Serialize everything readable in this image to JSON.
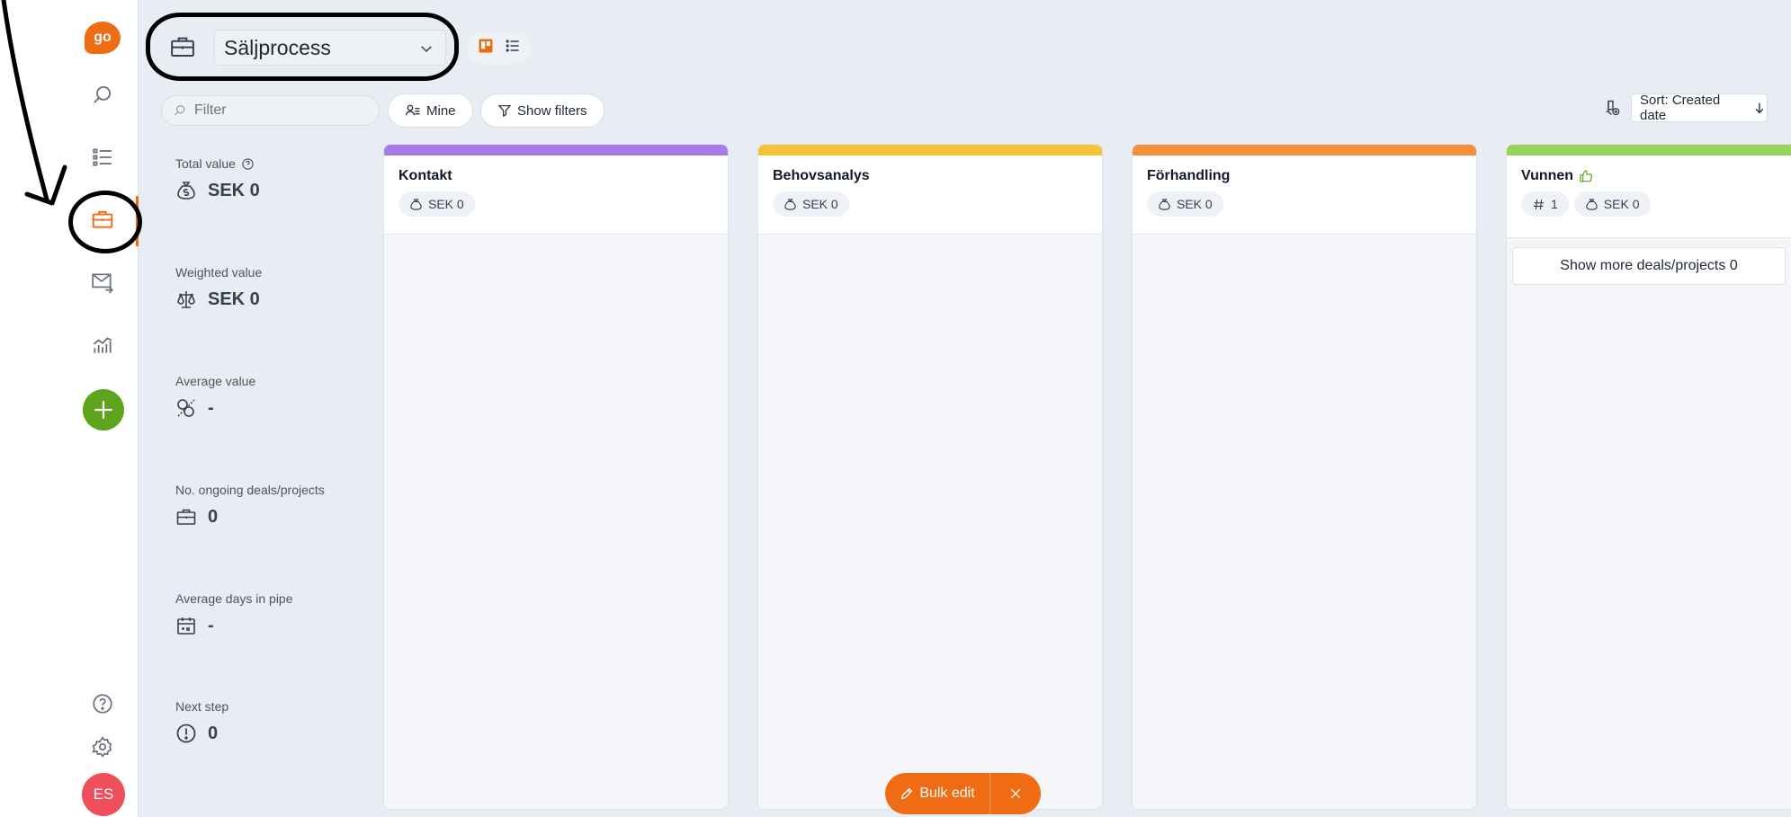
{
  "rail": {
    "logo_text": "go",
    "avatar_initials": "ES",
    "icons": [
      "search-icon",
      "list-icon",
      "briefcase-icon",
      "mail-forward-icon",
      "chart-icon",
      "help-icon",
      "settings-icon"
    ]
  },
  "header": {
    "pipeline_name": "Säljprocess"
  },
  "toolbar": {
    "filter_placeholder": "Filter",
    "mine_label": "Mine",
    "show_filters_label": "Show filters",
    "sort_label": "Sort: Created date"
  },
  "stats": [
    {
      "label": "Total value",
      "value": "SEK 0"
    },
    {
      "label": "Weighted value",
      "value": "SEK 0"
    },
    {
      "label": "Average value",
      "value": "-"
    },
    {
      "label": "No. ongoing deals/projects",
      "value": "0"
    },
    {
      "label": "Average days in pipe",
      "value": "-"
    },
    {
      "label": "Next step",
      "value": "0"
    }
  ],
  "columns": [
    {
      "title": "Kontakt",
      "value": "SEK 0",
      "color": "#a77be8"
    },
    {
      "title": "Behovsanalys",
      "value": "SEK 0",
      "color": "#f5c338"
    },
    {
      "title": "Förhandling",
      "value": "SEK 0",
      "color": "#f58f3c"
    },
    {
      "title": "Vunnen",
      "count": "1",
      "value": "SEK 0",
      "color": "#94d45a",
      "show_more": "Show more deals/projects 0"
    }
  ],
  "bulk": {
    "label": "Bulk edit"
  },
  "colors": {
    "accent": "#ef6c14",
    "add_button": "#5ea41d",
    "avatar": "#ef4f5a"
  }
}
